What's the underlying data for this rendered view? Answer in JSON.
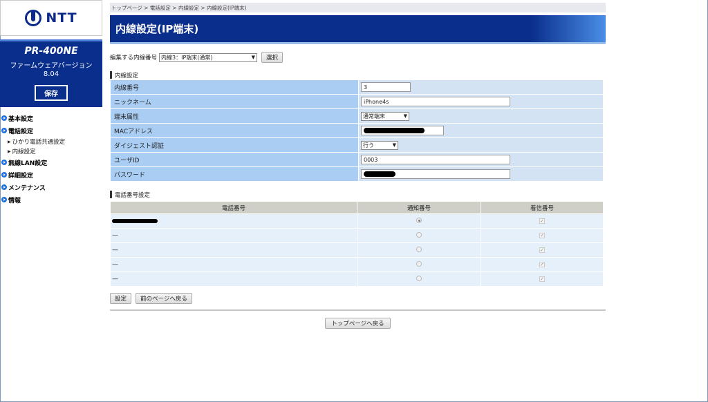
{
  "brand": {
    "logo": "NTT"
  },
  "device": {
    "model": "PR-400NE",
    "fw_label": "ファームウェアバージョン",
    "fw_version": "8.04",
    "save_label": "保存"
  },
  "nav": {
    "basic": "基本設定",
    "phone": "電話設定",
    "phone_sub_common": "ひかり電話共通設定",
    "phone_sub_ext": "内線設定",
    "wlan": "無線LAN設定",
    "detail": "詳細設定",
    "maintenance": "メンテナンス",
    "info": "情報"
  },
  "breadcrumb": "トップページ > 電話設定 > 内線設定 > 内線設定(IP端末)",
  "page_title": "内線設定(IP端末)",
  "select_row": {
    "label": "編集する内線番号",
    "selected": "内線3：IP端末(通常)",
    "select_button": "選択"
  },
  "ext_section": {
    "heading": "内線設定",
    "ext_number_label": "内線番号",
    "ext_number_value": "3",
    "nickname_label": "ニックネーム",
    "nickname_value": "iPhone4s",
    "attr_label": "端末属性",
    "attr_value": "通常端末",
    "mac_label": "MACアドレス",
    "digest_label": "ダイジェスト認証",
    "digest_value": "行う",
    "userid_label": "ユーザID",
    "userid_value": "0003",
    "password_label": "パスワード"
  },
  "phone_section": {
    "heading": "電話番号設定",
    "col_number": "電話番号",
    "col_notify": "通知番号",
    "col_incoming": "着信番号",
    "dash": "—"
  },
  "buttons": {
    "set": "設定",
    "back": "前のページへ戻る",
    "top": "トップページへ戻る"
  }
}
